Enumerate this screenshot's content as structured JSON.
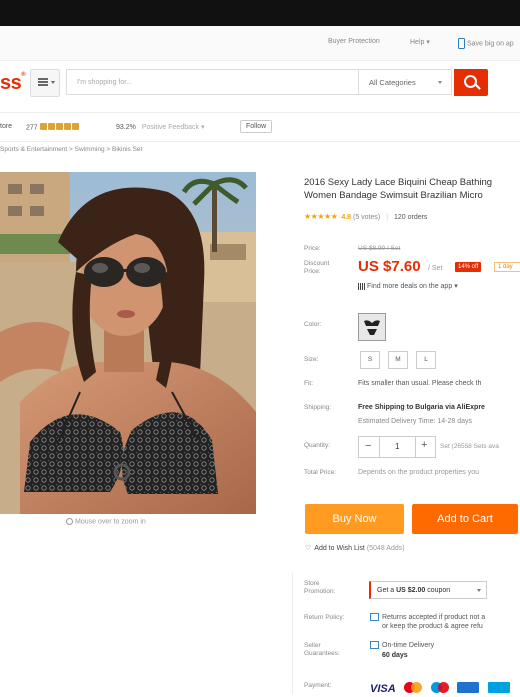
{
  "util": {
    "buyer_protection": "Buyer Protection",
    "help": "Help",
    "save_big": "Save big on ap"
  },
  "header": {
    "logo": "ss",
    "search_placeholder": "I'm shopping for...",
    "category": "All Categories"
  },
  "store": {
    "label": "tore",
    "count": "277",
    "feedback_pct": "93.2%",
    "feedback_label": "Positive Feedback",
    "follow": "Follow"
  },
  "breadcrumb": "Sports & Entertainment > Swimming > Bikinis Set",
  "product": {
    "title_line1": "2016 Sexy Lady Lace Biquini Cheap Bathing",
    "title_line2": "Women Bandage Swimsuit Brazilian Micro",
    "rating": "4.8",
    "votes": "(5 votes)",
    "orders": "120 orders"
  },
  "pricing": {
    "price_label": "Price:",
    "original": "US $8.90 / Set",
    "discount_label_1": "Discount",
    "discount_label_2": "Price:",
    "discount_price": "US $7.60",
    "per_set": "/ Set",
    "off_badge": "14% off",
    "day_badge": "1 day",
    "deals": "Find more deals on the app"
  },
  "options": {
    "color_label": "Color:",
    "size_label": "Size:",
    "sizes": [
      "S",
      "M",
      "L"
    ],
    "fit_label": "Fit:",
    "fit_text": "Fits smaller than usual. Please check th",
    "shipping_label": "Shipping:",
    "shipping_text": "Free Shipping to Bulgaria via AliExpre",
    "delivery_text": "Estimated Delivery Time: 14-28 days",
    "quantity_label": "Quantity:",
    "quantity": "1",
    "available": "Set (26558 Sets ava",
    "total_label": "Total Price:",
    "total_text": "Depends on the product properties you"
  },
  "actions": {
    "buy_now": "Buy Now",
    "add_to_cart": "Add to Cart",
    "wish": "Add to Wish List",
    "wish_count": "(5048 Adds)"
  },
  "promo": {
    "store_promo_label_1": "Store",
    "store_promo_label_2": "Promotion:",
    "coupon_prefix": "Get a",
    "coupon_value": "US $2.00",
    "coupon_suffix": "coupon",
    "return_label": "Return Policy:",
    "return_line1": "Returns accepted if product not a",
    "return_line2": "or keep the product & agree refu",
    "guarantee_label_1": "Seller",
    "guarantee_label_2": "Guarantees:",
    "guarantee_line1": "On-time Delivery",
    "guarantee_line2": "60 days",
    "payment_label": "Payment:",
    "visa": "VISA"
  },
  "photo": {
    "zoom_hint": "Mouse over to zoom in"
  },
  "colors": {
    "accent": "#e62e04",
    "buy": "#ff9b21",
    "cart": "#ff6a00",
    "star": "#f2a400"
  }
}
